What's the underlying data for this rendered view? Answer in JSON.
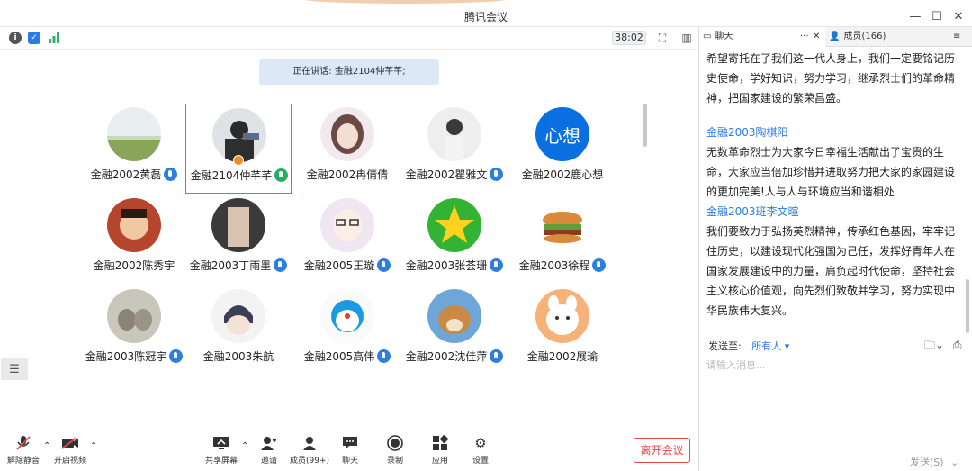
{
  "window": {
    "title": "腾讯会议",
    "controls": [
      "minimize-icon",
      "maximize-icon",
      "close-icon"
    ]
  },
  "toolbar": {
    "info_icon": "info-icon",
    "shield_icon": "shield-icon",
    "signal_icon": "signal-icon",
    "timer": "38:02",
    "fullscreen_icon": "fullscreen-icon",
    "layout_icon": "layout-icon"
  },
  "speaking": "正在讲话: 金融2104仲芊芊;",
  "participants": [
    {
      "name": "金融2002黄磊",
      "mic": "blue"
    },
    {
      "name": "金融2104仲芊芊",
      "mic": "green",
      "active": true
    },
    {
      "name": "金融2002冉倩倩",
      "mic": "none"
    },
    {
      "name": "金融2002瞿雅文",
      "mic": "blue"
    },
    {
      "name": "金融2002鹿心想",
      "mic": "none",
      "avatar_text": "心想"
    },
    {
      "name": "金融2002陈秀宇",
      "mic": "none"
    },
    {
      "name": "金融2003丁雨墨",
      "mic": "blue"
    },
    {
      "name": "金融2005王璇",
      "mic": "blue"
    },
    {
      "name": "金融2003张荟珊",
      "mic": "blue"
    },
    {
      "name": "金融2003徐程",
      "mic": "blue"
    },
    {
      "name": "金融2003陈冠宇",
      "mic": "blue"
    },
    {
      "name": "金融2003朱航",
      "mic": "none"
    },
    {
      "name": "金融2005高伟",
      "mic": "blue"
    },
    {
      "name": "金融2002沈佳萍",
      "mic": "blue"
    },
    {
      "name": "金融2002展瑜",
      "mic": "none"
    }
  ],
  "bottom": {
    "unmute": "解除静音",
    "start_video": "开启视频",
    "share": "共享屏幕",
    "invite": "邀请",
    "members": "成员(99+)",
    "chat": "聊天",
    "record": "录制",
    "apps": "应用",
    "settings": "设置",
    "leave": "离开会议"
  },
  "panel": {
    "chat_tab": "聊天",
    "members_tab": "成员(166)",
    "messages": [
      {
        "sender": "",
        "text": "希望寄托在了我们这一代人身上，我们一定要铭记历史使命，学好知识，努力学习，继承烈士们的革命精神，把国家建设的繁荣昌盛。"
      },
      {
        "sender": "金融2003陶棋阳",
        "text": "无数革命烈士为大家今日幸福生活献出了宝贵的生命，大家应当倍加珍惜并进取努力把大家的家园建设的更加完美!人与人与环境应当和谐相处"
      },
      {
        "sender": "金融2003班李文暄",
        "text": "我们要致力于弘扬英烈精神，传承红色基因，牢牢记住历史，以建设现代化强国为己任，发挥好青年人在国家发展建设中的力量，肩负起时代使命，坚持社会主义核心价值观，向先烈们致敬并学习，努力实现中华民族伟大复兴。"
      }
    ],
    "send_to_label": "发送至:",
    "send_to_target": "所有人",
    "input_placeholder": "请输入消息...",
    "send_label": "发送(S)"
  }
}
